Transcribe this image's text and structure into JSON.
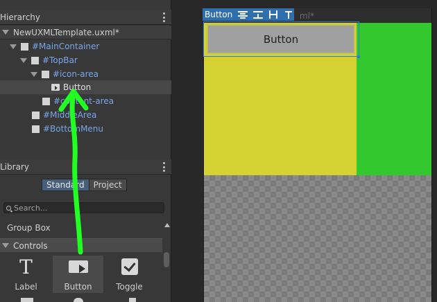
{
  "hierarchy": {
    "title": "Hierarchy",
    "root": "NewUXMLTemplate.uxml*",
    "items": [
      {
        "label": "#MainContainer"
      },
      {
        "label": "#TopBar"
      },
      {
        "label": "#icon-area"
      },
      {
        "label": "Button"
      },
      {
        "label": "#content-area"
      },
      {
        "label": "#MiddleArea"
      },
      {
        "label": "#BottomMenu"
      }
    ]
  },
  "library": {
    "title": "Library",
    "tabs": [
      {
        "label": "Standard"
      },
      {
        "label": "Project"
      }
    ],
    "search_placeholder": "Search...",
    "group_box": "Group Box",
    "controls_header": "Controls",
    "items": [
      {
        "label": "Label",
        "icon": "T"
      },
      {
        "label": "Button",
        "icon": "button-icon"
      },
      {
        "label": "Toggle",
        "icon": "checkbox-icon"
      }
    ]
  },
  "viewport": {
    "toolbar_label": "Button",
    "tab_suffix": "ml*",
    "button_text": "Button"
  },
  "colors": {
    "yellow": "#d4d232",
    "green": "#34c82f",
    "accent": "#2f6fae",
    "annotation": "#22ff22"
  }
}
